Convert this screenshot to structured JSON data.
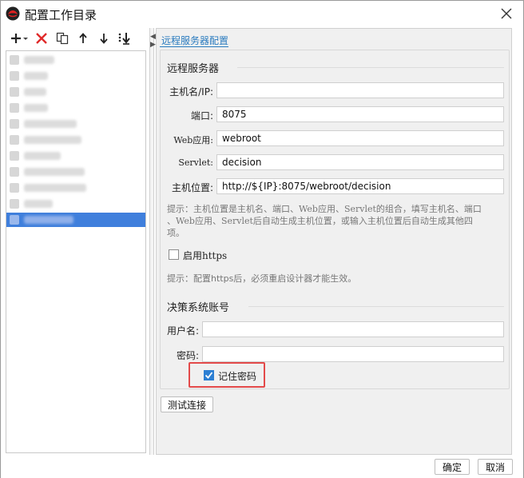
{
  "window": {
    "title": "配置工作目录"
  },
  "left_panel": {
    "toolbar": {
      "add_icon": "plus-with-dropdown",
      "delete_icon": "red-x",
      "copy_icon": "copy-pages",
      "up_icon": "arrow-up",
      "down_icon": "arrow-down",
      "bottom_icon": "move-to-bottom"
    }
  },
  "right_panel": {
    "tab_title": "远程服务器配置",
    "remote_server": {
      "section_title": "远程服务器",
      "host_label": "主机名/IP:",
      "host_value": "",
      "port_label": "端口:",
      "port_value": "8075",
      "webapp_label": "Web应用:",
      "webapp_value": "webroot",
      "servlet_label": "Servlet:",
      "servlet_value": "decision",
      "location_label": "主机位置:",
      "location_value": "http://${IP}:8075/webroot/decision",
      "hint_line1": "提示：主机位置是主机名、端口、Web应用、Servlet的组合，填写主机名、端口",
      "hint_line2": "、Web应用、Servlet后自动生成主机位置，或输入主机位置后自动生成其他四",
      "hint_line3": "项。",
      "https_label": "启用https",
      "https_checked": false,
      "https_hint": "提示：配置https后，必须重启设计器才能生效。"
    },
    "account": {
      "section_title": "决策系统账号",
      "username_label": "用户名:",
      "username_value": "",
      "password_label": "密码:",
      "password_value": "",
      "remember_label": "记住密码",
      "remember_checked": true
    },
    "test_button": "测试连接"
  },
  "footer": {
    "ok_button": "确定",
    "cancel_button": "取消"
  },
  "colors": {
    "accent": "#2a7bbf",
    "selection": "#3f7fdc",
    "highlight": "#e34a4a",
    "checkbox": "#2d7fd3"
  }
}
